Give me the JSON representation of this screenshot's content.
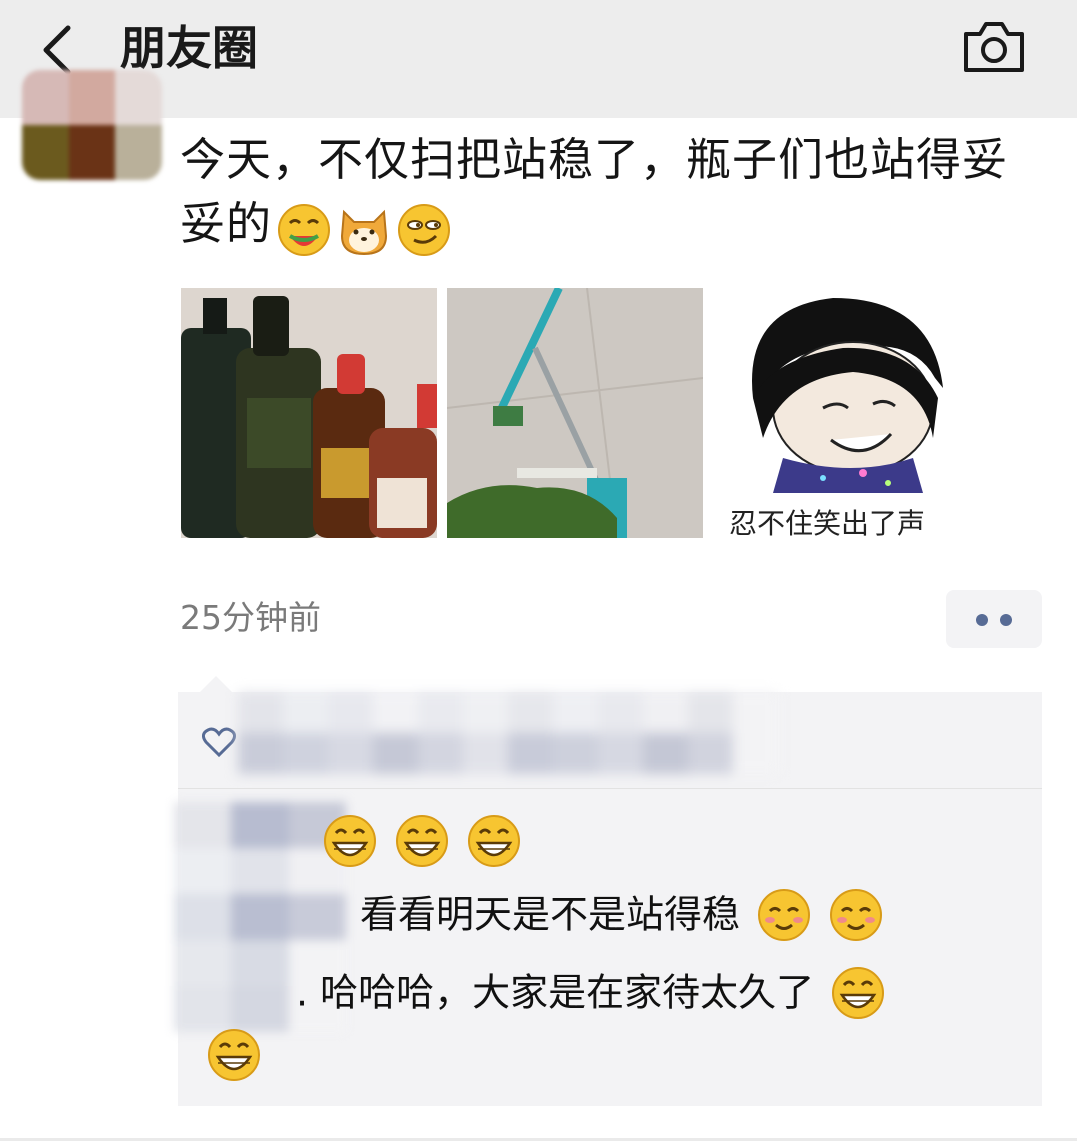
{
  "header": {
    "title": "朋友圈",
    "back_icon": "chevron-left-icon",
    "camera_icon": "camera-icon",
    "background": "#ededed"
  },
  "post": {
    "text": "今天，不仅扫把站稳了，瓶子们也站得妥妥的",
    "emojis": [
      "watermelon-grin-emoji",
      "shiba-dog-emoji",
      "smirk-emoji"
    ],
    "images": [
      {
        "name": "bottles-photo"
      },
      {
        "name": "broom-photo"
      },
      {
        "name": "meme-sticker",
        "caption": "忍不住笑出了声"
      }
    ],
    "time": "25分钟前",
    "link_color": "#576b95"
  },
  "interactions": {
    "like_icon": "heart-outline-icon",
    "comments": [
      {
        "text": "",
        "emojis": [
          "grin-emoji",
          "grin-emoji",
          "grin-emoji"
        ]
      },
      {
        "text": "看看明天是不是站得稳",
        "emojis": [
          "blush-emoji",
          "blush-emoji"
        ]
      },
      {
        "text": ". 哈哈哈，大家是在家待太久了",
        "emojis": [
          "grin-emoji"
        ]
      },
      {
        "text": "",
        "emojis": [
          "grin-emoji"
        ]
      }
    ]
  }
}
